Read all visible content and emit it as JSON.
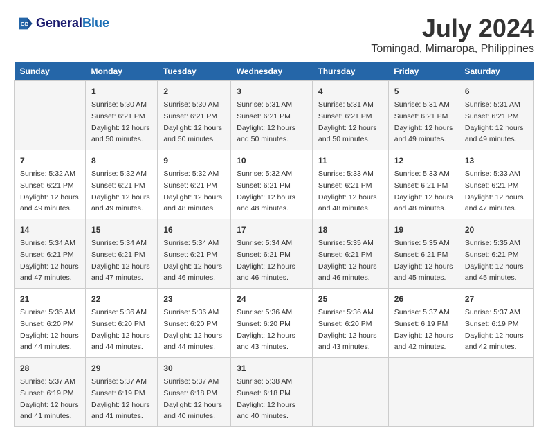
{
  "logo": {
    "line1": "General",
    "line2": "Blue"
  },
  "title": "July 2024",
  "subtitle": "Tomingad, Mimaropa, Philippines",
  "days_header": [
    "Sunday",
    "Monday",
    "Tuesday",
    "Wednesday",
    "Thursday",
    "Friday",
    "Saturday"
  ],
  "weeks": [
    [
      {
        "day": "",
        "sunrise": "",
        "sunset": "",
        "daylight": ""
      },
      {
        "day": "1",
        "sunrise": "Sunrise: 5:30 AM",
        "sunset": "Sunset: 6:21 PM",
        "daylight": "Daylight: 12 hours and 50 minutes."
      },
      {
        "day": "2",
        "sunrise": "Sunrise: 5:30 AM",
        "sunset": "Sunset: 6:21 PM",
        "daylight": "Daylight: 12 hours and 50 minutes."
      },
      {
        "day": "3",
        "sunrise": "Sunrise: 5:31 AM",
        "sunset": "Sunset: 6:21 PM",
        "daylight": "Daylight: 12 hours and 50 minutes."
      },
      {
        "day": "4",
        "sunrise": "Sunrise: 5:31 AM",
        "sunset": "Sunset: 6:21 PM",
        "daylight": "Daylight: 12 hours and 50 minutes."
      },
      {
        "day": "5",
        "sunrise": "Sunrise: 5:31 AM",
        "sunset": "Sunset: 6:21 PM",
        "daylight": "Daylight: 12 hours and 49 minutes."
      },
      {
        "day": "6",
        "sunrise": "Sunrise: 5:31 AM",
        "sunset": "Sunset: 6:21 PM",
        "daylight": "Daylight: 12 hours and 49 minutes."
      }
    ],
    [
      {
        "day": "7",
        "sunrise": "Sunrise: 5:32 AM",
        "sunset": "Sunset: 6:21 PM",
        "daylight": "Daylight: 12 hours and 49 minutes."
      },
      {
        "day": "8",
        "sunrise": "Sunrise: 5:32 AM",
        "sunset": "Sunset: 6:21 PM",
        "daylight": "Daylight: 12 hours and 49 minutes."
      },
      {
        "day": "9",
        "sunrise": "Sunrise: 5:32 AM",
        "sunset": "Sunset: 6:21 PM",
        "daylight": "Daylight: 12 hours and 48 minutes."
      },
      {
        "day": "10",
        "sunrise": "Sunrise: 5:32 AM",
        "sunset": "Sunset: 6:21 PM",
        "daylight": "Daylight: 12 hours and 48 minutes."
      },
      {
        "day": "11",
        "sunrise": "Sunrise: 5:33 AM",
        "sunset": "Sunset: 6:21 PM",
        "daylight": "Daylight: 12 hours and 48 minutes."
      },
      {
        "day": "12",
        "sunrise": "Sunrise: 5:33 AM",
        "sunset": "Sunset: 6:21 PM",
        "daylight": "Daylight: 12 hours and 48 minutes."
      },
      {
        "day": "13",
        "sunrise": "Sunrise: 5:33 AM",
        "sunset": "Sunset: 6:21 PM",
        "daylight": "Daylight: 12 hours and 47 minutes."
      }
    ],
    [
      {
        "day": "14",
        "sunrise": "Sunrise: 5:34 AM",
        "sunset": "Sunset: 6:21 PM",
        "daylight": "Daylight: 12 hours and 47 minutes."
      },
      {
        "day": "15",
        "sunrise": "Sunrise: 5:34 AM",
        "sunset": "Sunset: 6:21 PM",
        "daylight": "Daylight: 12 hours and 47 minutes."
      },
      {
        "day": "16",
        "sunrise": "Sunrise: 5:34 AM",
        "sunset": "Sunset: 6:21 PM",
        "daylight": "Daylight: 12 hours and 46 minutes."
      },
      {
        "day": "17",
        "sunrise": "Sunrise: 5:34 AM",
        "sunset": "Sunset: 6:21 PM",
        "daylight": "Daylight: 12 hours and 46 minutes."
      },
      {
        "day": "18",
        "sunrise": "Sunrise: 5:35 AM",
        "sunset": "Sunset: 6:21 PM",
        "daylight": "Daylight: 12 hours and 46 minutes."
      },
      {
        "day": "19",
        "sunrise": "Sunrise: 5:35 AM",
        "sunset": "Sunset: 6:21 PM",
        "daylight": "Daylight: 12 hours and 45 minutes."
      },
      {
        "day": "20",
        "sunrise": "Sunrise: 5:35 AM",
        "sunset": "Sunset: 6:21 PM",
        "daylight": "Daylight: 12 hours and 45 minutes."
      }
    ],
    [
      {
        "day": "21",
        "sunrise": "Sunrise: 5:35 AM",
        "sunset": "Sunset: 6:20 PM",
        "daylight": "Daylight: 12 hours and 44 minutes."
      },
      {
        "day": "22",
        "sunrise": "Sunrise: 5:36 AM",
        "sunset": "Sunset: 6:20 PM",
        "daylight": "Daylight: 12 hours and 44 minutes."
      },
      {
        "day": "23",
        "sunrise": "Sunrise: 5:36 AM",
        "sunset": "Sunset: 6:20 PM",
        "daylight": "Daylight: 12 hours and 44 minutes."
      },
      {
        "day": "24",
        "sunrise": "Sunrise: 5:36 AM",
        "sunset": "Sunset: 6:20 PM",
        "daylight": "Daylight: 12 hours and 43 minutes."
      },
      {
        "day": "25",
        "sunrise": "Sunrise: 5:36 AM",
        "sunset": "Sunset: 6:20 PM",
        "daylight": "Daylight: 12 hours and 43 minutes."
      },
      {
        "day": "26",
        "sunrise": "Sunrise: 5:37 AM",
        "sunset": "Sunset: 6:19 PM",
        "daylight": "Daylight: 12 hours and 42 minutes."
      },
      {
        "day": "27",
        "sunrise": "Sunrise: 5:37 AM",
        "sunset": "Sunset: 6:19 PM",
        "daylight": "Daylight: 12 hours and 42 minutes."
      }
    ],
    [
      {
        "day": "28",
        "sunrise": "Sunrise: 5:37 AM",
        "sunset": "Sunset: 6:19 PM",
        "daylight": "Daylight: 12 hours and 41 minutes."
      },
      {
        "day": "29",
        "sunrise": "Sunrise: 5:37 AM",
        "sunset": "Sunset: 6:19 PM",
        "daylight": "Daylight: 12 hours and 41 minutes."
      },
      {
        "day": "30",
        "sunrise": "Sunrise: 5:37 AM",
        "sunset": "Sunset: 6:18 PM",
        "daylight": "Daylight: 12 hours and 40 minutes."
      },
      {
        "day": "31",
        "sunrise": "Sunrise: 5:38 AM",
        "sunset": "Sunset: 6:18 PM",
        "daylight": "Daylight: 12 hours and 40 minutes."
      },
      {
        "day": "",
        "sunrise": "",
        "sunset": "",
        "daylight": ""
      },
      {
        "day": "",
        "sunrise": "",
        "sunset": "",
        "daylight": ""
      },
      {
        "day": "",
        "sunrise": "",
        "sunset": "",
        "daylight": ""
      }
    ]
  ]
}
